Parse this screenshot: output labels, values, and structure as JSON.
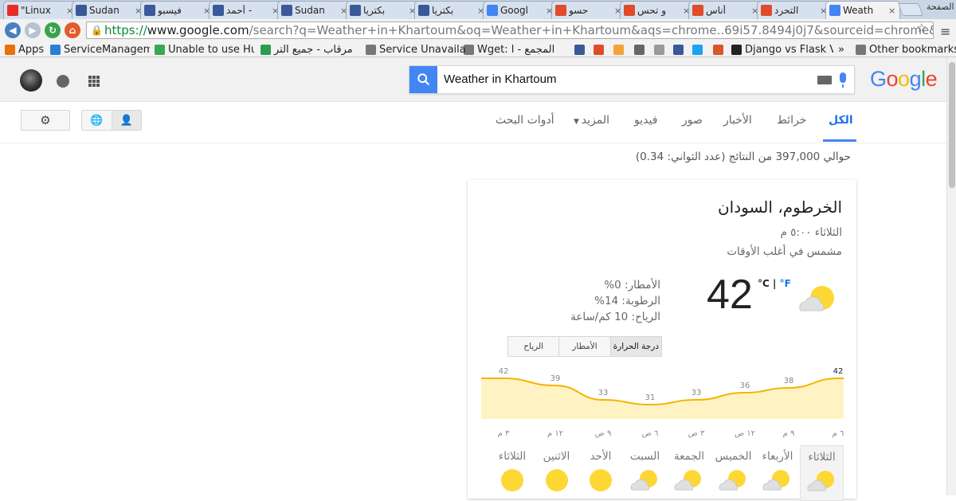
{
  "tabs": [
    {
      "title": "\"Linux",
      "icon": "youtube-icon",
      "color": "#e52d27"
    },
    {
      "title": "Sudan",
      "icon": "facebook-icon",
      "color": "#3b5998"
    },
    {
      "title": "فيسبو",
      "icon": "facebook-icon",
      "color": "#3b5998"
    },
    {
      "title": "أحمد -",
      "icon": "facebook-icon",
      "color": "#3b5998"
    },
    {
      "title": "Sudan",
      "icon": "facebook-icon",
      "color": "#3b5998"
    },
    {
      "title": "بكتريا",
      "icon": "facebook-icon",
      "color": "#3b5998"
    },
    {
      "title": "بكتريا",
      "icon": "facebook-icon",
      "color": "#3b5998"
    },
    {
      "title": "Googl",
      "icon": "google-icon",
      "color": "#4285f4"
    },
    {
      "title": "حسو",
      "icon": "blogger-icon",
      "color": "#e04c2b"
    },
    {
      "title": "و تحس",
      "icon": "blogger-icon",
      "color": "#e04c2b"
    },
    {
      "title": "أناس",
      "icon": "blogger-icon",
      "color": "#e04c2b"
    },
    {
      "title": "التحرد",
      "icon": "blogger-icon",
      "color": "#e04c2b"
    },
    {
      "title": "Weath",
      "icon": "google-icon",
      "color": "#4285f4",
      "active": true
    }
  ],
  "corner_label": "الصفحة",
  "url": {
    "scheme": "https://",
    "host": "www.google.com",
    "rest": "/search?q=Weather+in+Khartoum&oq=Weather+in+Khartoum&aqs=chrome..69i57.8494j0j7&sourceid=chrome&ie=UTF-8"
  },
  "bookmarks": [
    {
      "label": "Apps",
      "icon": "apps-icon",
      "color": "#e8710a"
    },
    {
      "label": "ServiceManageme",
      "icon": "servicemanager-icon",
      "color": "#2a7fd4"
    },
    {
      "label": "Unable to use Hu",
      "icon": "page-icon",
      "color": "#3aa757"
    },
    {
      "label": "مرقاب - جميع التر",
      "icon": "marqab-icon",
      "color": "#2e9c4e"
    },
    {
      "label": "Service Unavailab",
      "icon": "file-icon",
      "color": "#777777"
    },
    {
      "label": "Wget: المجمع - ا",
      "icon": "file-icon",
      "color": "#777777"
    },
    {
      "label": "",
      "icon": "facebook-icon",
      "color": "#3b5998"
    },
    {
      "label": "",
      "icon": "blogger-icon",
      "color": "#e04c2b"
    },
    {
      "label": "",
      "icon": "smiley-icon",
      "color": "#f2a33a"
    },
    {
      "label": "",
      "icon": "bookmark-icon",
      "color": "#666666"
    },
    {
      "label": "",
      "icon": "page-icon",
      "color": "#999999"
    },
    {
      "label": "",
      "icon": "facebook-icon",
      "color": "#3b5998"
    },
    {
      "label": "",
      "icon": "twitter-icon",
      "color": "#1da1f2"
    },
    {
      "label": "",
      "icon": "cat-icon",
      "color": "#d8572a"
    },
    {
      "label": "Django vs Flask V",
      "icon": "github-icon",
      "color": "#222222"
    }
  ],
  "bookmarks_overflow": "»",
  "other_bookmarks": "Other bookmarks",
  "search": {
    "query": "Weather in Khartoum"
  },
  "logo": {
    "letters": [
      "G",
      "o",
      "o",
      "g",
      "l",
      "e"
    ],
    "colors": [
      "#4285f4",
      "#ea4335",
      "#fbbc05",
      "#4285f4",
      "#34a853",
      "#ea4335"
    ]
  },
  "nav": {
    "all": "الكل",
    "maps": "خرائط",
    "news": "الأخبار",
    "images": "صور",
    "videos": "فيديو",
    "more": "المزيد",
    "tools": "أدوات البحث"
  },
  "result_stats": "حوالي 397,000 من النتائج (عدد الثواني: 0.34)",
  "weather": {
    "location": "الخرطوم، السودان",
    "time": "الثلاثاء ٥:٠٠ م",
    "condition": "مشمس في أغلب الأوقات",
    "temp": "42",
    "unit_c": "°C",
    "unit_sep": " | ",
    "unit_f": "°F",
    "precip": "الأمطار: 0%",
    "humidity": "الرطوبة: 14%",
    "wind": "الرياح: 10 كم/ساعة",
    "chart_tabs": [
      "درجة الحرارة",
      "الأمطار",
      "الرياح"
    ],
    "hours": [
      "٦ م",
      "٩ م",
      "١٢ ص",
      "٣ ص",
      "٦ ص",
      "٩ ص",
      "١٢ م",
      "٣ م"
    ],
    "days": [
      {
        "name": "الثلاثاء",
        "icon": "partly-sunny-icon",
        "selected": true
      },
      {
        "name": "الأربعاء",
        "icon": "partly-sunny-icon"
      },
      {
        "name": "الخميس",
        "icon": "partly-sunny-icon"
      },
      {
        "name": "الجمعة",
        "icon": "partly-sunny-icon"
      },
      {
        "name": "السبت",
        "icon": "partly-sunny-icon"
      },
      {
        "name": "الأحد",
        "icon": "sunny-icon"
      },
      {
        "name": "الاثنين",
        "icon": "sunny-icon"
      },
      {
        "name": "الثلاثاء",
        "icon": "sunny-icon"
      }
    ]
  },
  "chart_data": {
    "type": "area",
    "x": [
      "٣ م",
      "١٢ م",
      "٩ ص",
      "٦ ص",
      "٣ ص",
      "١٢ ص",
      "٩ م",
      "٦ م"
    ],
    "series": [
      {
        "values": [
          42,
          39,
          33,
          31,
          33,
          36,
          38,
          42
        ]
      }
    ],
    "ylim": [
      25,
      45
    ],
    "fill_color": "#fff3c4",
    "line_color": "#f4b400"
  }
}
